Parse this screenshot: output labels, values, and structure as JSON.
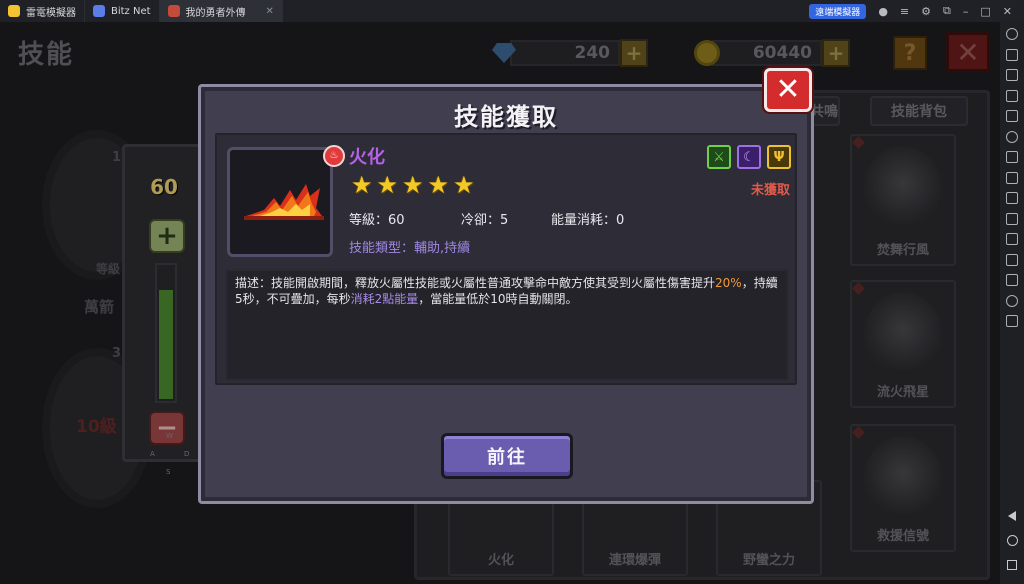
{
  "emulator": {
    "tabs": [
      {
        "label": "雷電模擬器",
        "color": "#f4c430"
      },
      {
        "label": "Bitz Net",
        "color": "#5b7de8"
      },
      {
        "label": "我的勇者外傳",
        "color": "#c44a3a"
      }
    ],
    "accelerator_label": "遠端模擬器",
    "sidebar_icon_count": 19
  },
  "game": {
    "page_title": "技能",
    "gems": "240",
    "coins": "60440",
    "help_label": "?",
    "close_label": "✕",
    "bg_tabs": [
      "技能共鳴",
      "技能背包"
    ],
    "bg_left": {
      "level_label": "等級",
      "arrow_label": "萬箭",
      "level10_label": "10級",
      "small1": "1",
      "small2": "3"
    },
    "bg_cards": [
      {
        "name": "焚舞行風"
      },
      {
        "name": "流火飛星"
      },
      {
        "name": "救援信號"
      },
      {
        "name": "火化"
      },
      {
        "name": "連環爆彈"
      },
      {
        "name": "野蠻之力"
      }
    ],
    "slider": {
      "value": "60",
      "plus": "+",
      "minus": "−",
      "fill_fraction": 0.8,
      "keys": {
        "w": "W",
        "a": "A",
        "d": "D",
        "s": "S"
      }
    }
  },
  "dialog": {
    "title": "技能獲取",
    "close_label": "✕",
    "skill": {
      "name": "火化",
      "stars": 5,
      "status": "未獲取",
      "level": "等級：60",
      "cooldown": "冷卻：5",
      "energy": "能量消耗：0",
      "type": "技能類型：輔助,持續",
      "badges": [
        {
          "icon": "sword-icon",
          "glyph": "⚔",
          "color": "#6fd04a"
        },
        {
          "icon": "magic-icon",
          "glyph": "☾",
          "color": "#a06ee6"
        },
        {
          "icon": "trident-icon",
          "glyph": "Ψ",
          "color": "#f0c030"
        }
      ]
    },
    "description": {
      "part1": "描述：技能開啟期間，釋放火屬性技能或火屬性普通攻擊命中敵方使其受到火屬性傷害提升",
      "highlight1": "20%",
      "part2": "，持續5秒，不可疊加，每秒",
      "highlight2": "消耗2點能量",
      "part3": "，當能量低於10時自動關閉。"
    },
    "go_button": "前往"
  }
}
